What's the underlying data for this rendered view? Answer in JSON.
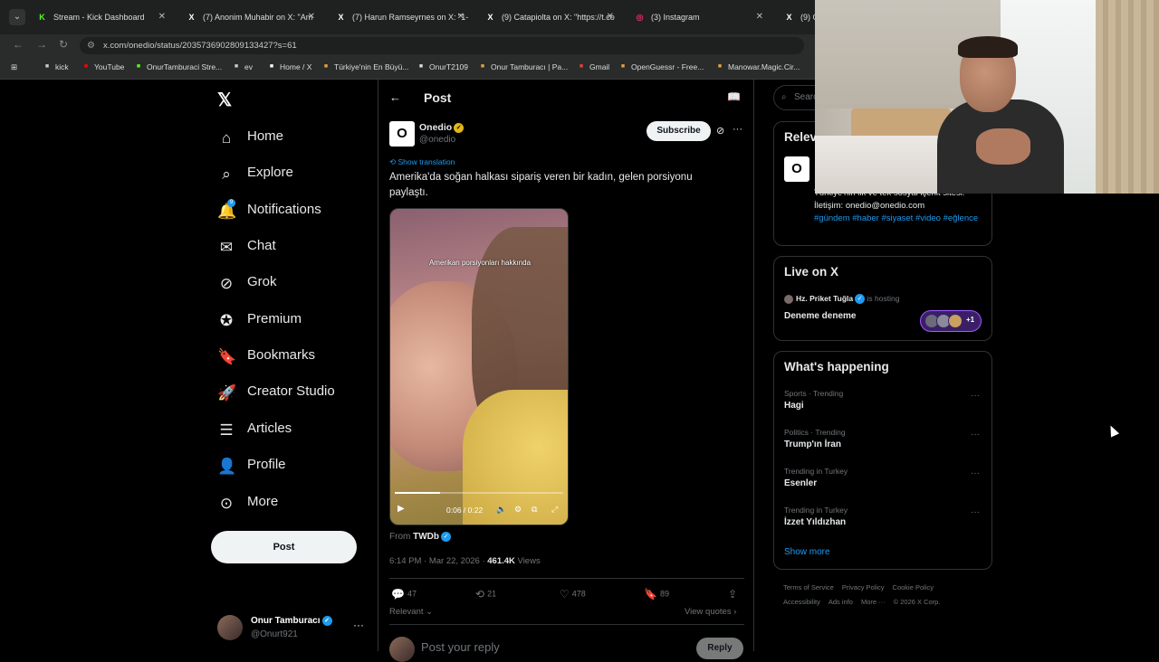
{
  "browser": {
    "tabs": [
      {
        "title": "Stream - Kick Dashboard",
        "favicon": "kick-icon",
        "color": "#53fc18",
        "glyph": "K"
      },
      {
        "title": "(7) Anonim Muhabir on X: \"Am",
        "favicon": "x-icon",
        "color": "#ffffff",
        "glyph": "X"
      },
      {
        "title": "(7) Harun Ramseyrnes on X: \"1-",
        "favicon": "x-icon",
        "color": "#ffffff",
        "glyph": "X"
      },
      {
        "title": "(9) Catapiolta on X: \"https://t.co",
        "favicon": "x-icon",
        "color": "#ffffff",
        "glyph": "X"
      },
      {
        "title": "(3) Instagram",
        "favicon": "instagram-icon",
        "color": "#e1306c",
        "glyph": "◎"
      },
      {
        "title": "(9) On",
        "favicon": "x-icon",
        "color": "#ffffff",
        "glyph": "X"
      }
    ],
    "url": "x.com/onedio/status/2035736902809133427?s=61",
    "bookmarks": [
      {
        "label": "kick",
        "icon": "folder-icon"
      },
      {
        "label": "YouTube",
        "icon": "youtube-icon"
      },
      {
        "label": "OnurTamburaci Stre...",
        "icon": "kick-icon"
      },
      {
        "label": "ev",
        "icon": "folder-icon"
      },
      {
        "label": "Home / X",
        "icon": "x-icon"
      },
      {
        "label": "Türkiye'nin En Büyü...",
        "icon": "site-icon"
      },
      {
        "label": "OnurT2109",
        "icon": "github-icon"
      },
      {
        "label": "Onur Tamburacı | Pa...",
        "icon": "site-icon"
      },
      {
        "label": "Gmail",
        "icon": "gmail-icon"
      },
      {
        "label": "OpenGuessr - Free...",
        "icon": "site-icon"
      },
      {
        "label": "Manowar.Magic.Cir...",
        "icon": "site-icon"
      }
    ]
  },
  "nav": {
    "items": [
      {
        "label": "Home",
        "icon": "home-icon"
      },
      {
        "label": "Explore",
        "icon": "search-icon"
      },
      {
        "label": "Notifications",
        "icon": "bell-icon",
        "badge": "9"
      },
      {
        "label": "Chat",
        "icon": "mail-icon"
      },
      {
        "label": "Grok",
        "icon": "grok-icon"
      },
      {
        "label": "Premium",
        "icon": "premium-icon"
      },
      {
        "label": "Bookmarks",
        "icon": "bookmark-icon"
      },
      {
        "label": "Creator Studio",
        "icon": "rocket-icon"
      },
      {
        "label": "Articles",
        "icon": "articles-icon"
      },
      {
        "label": "Profile",
        "icon": "person-icon"
      },
      {
        "label": "More",
        "icon": "more-circle-icon"
      }
    ],
    "post_label": "Post",
    "account": {
      "name": "Onur Tamburacı",
      "handle": "@Onurt921"
    }
  },
  "post": {
    "header_title": "Post",
    "author_name": "Onedio",
    "author_handle": "@onedio",
    "subscribe_label": "Subscribe",
    "show_translation": "Show translation",
    "text": "Amerika'da soğan halkası sipariş veren bir kadın, gelen porsiyonu paylaştı.",
    "video": {
      "caption": "Amerikan porsiyonları hakkında",
      "time": "0:06 / 0:22",
      "progress": 0.27
    },
    "from_label": "From",
    "from_source": "TWDb",
    "timestamp": "6:14 PM · Mar 22, 2026 ·",
    "views_count": "461.4K",
    "views_label": "Views",
    "stats": {
      "replies": "47",
      "reposts": "21",
      "likes": "478",
      "bookmarks": "89"
    },
    "relevant_label": "Relevant",
    "view_quotes_label": "View quotes",
    "reply_placeholder": "Post your reply",
    "reply_button": "Reply"
  },
  "sidebar": {
    "search_placeholder": "Search",
    "relevant": {
      "title": "Relev",
      "bio": "Türkiye'nin ilk ve tek sosyal içerik sitesi! İletişim: onedio@onedio.com",
      "tags": "#gündem #haber #siyaset #video #eğlence"
    },
    "live": {
      "title": "Live on X",
      "host": "Hz. Priket Tuğla",
      "hosting_label": "is hosting",
      "space_title": "Deneme deneme",
      "listeners_extra": "+1"
    },
    "happening": {
      "title": "What's happening",
      "trends": [
        {
          "category": "Sports · Trending",
          "name": "Hagi"
        },
        {
          "category": "Politics · Trending",
          "name": "Trump'ın İran"
        },
        {
          "category": "Trending in Turkey",
          "name": "Esenler"
        },
        {
          "category": "Trending in Turkey",
          "name": "İzzet Yıldızhan"
        }
      ],
      "show_more": "Show more"
    },
    "footer": {
      "line1": [
        "Terms of Service",
        "Privacy Policy",
        "Cookie Policy"
      ],
      "line2": [
        "Accessibility",
        "Ads info",
        "More ···",
        "© 2026 X Corp."
      ]
    }
  }
}
